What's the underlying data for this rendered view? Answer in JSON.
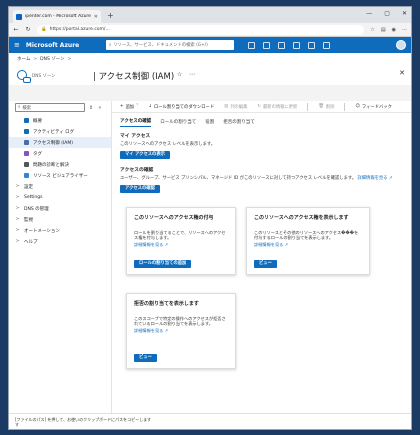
{
  "browser": {
    "tab_title": "ipenter.com - Microsoft Azure",
    "tab_close": "✕",
    "new_tab": "+",
    "url": "https://portal.azure.com/...",
    "window_controls": [
      "—",
      "▢",
      "✕"
    ]
  },
  "azure": {
    "brand": "Microsoft Azure",
    "search_placeholder": "リソース、サービス、ドキュメントの検索 (G+/)"
  },
  "breadcrumb": [
    "ホーム",
    "DNS ゾーン"
  ],
  "resource": {
    "name": "",
    "sub": "DNS ゾーン",
    "page_title": "| アクセス制御 (IAM)"
  },
  "sidebar": {
    "search_placeholder": "検索",
    "items": [
      {
        "label": "概要",
        "chev": "",
        "icon_color": "#0f6cbd"
      },
      {
        "label": "アクティビティ ログ",
        "chev": "",
        "icon_color": "#0f6cbd"
      },
      {
        "label": "アクセス制御 (IAM)",
        "chev": "",
        "icon_color": "#4a6ea9",
        "active": true
      },
      {
        "label": "タグ",
        "chev": "",
        "icon_color": "#8a4fc1"
      },
      {
        "label": "問題の診断と解決",
        "chev": "",
        "icon_color": "#555555"
      },
      {
        "label": "リソース ビジュアライザー",
        "chev": "",
        "icon_color": "#2b88d8"
      },
      {
        "label": "設定",
        "chev": ">",
        "icon_color": ""
      },
      {
        "label": "Settings",
        "chev": ">",
        "icon_color": ""
      },
      {
        "label": "DNS の管理",
        "chev": ">",
        "icon_color": ""
      },
      {
        "label": "監視",
        "chev": ">",
        "icon_color": ""
      },
      {
        "label": "オートメーション",
        "chev": ">",
        "icon_color": ""
      },
      {
        "label": "ヘルプ",
        "chev": ">",
        "icon_color": ""
      }
    ]
  },
  "toolbar": {
    "add": "追加",
    "download": "ロール割り当てのダウンロード",
    "edit_columns": "列の編集",
    "refresh": "最新の情報に更新",
    "delete": "削除",
    "feedback": "フィードバック"
  },
  "tabs": [
    "アクセスの確認",
    "ロールの割り当て",
    "役割",
    "拒否の割り当て"
  ],
  "my_access": {
    "title": "マイ アクセス",
    "desc": "このリソースへのアクセス レベルを表示します。",
    "button": "マイ アクセスの表示"
  },
  "check_access": {
    "title": "アクセスの確認",
    "desc": "ユーザー、グループ、サービス プリンシパル、マネージド ID がこのリソースに対して持つアクセス レベルを確認します。",
    "link": "詳細情報を見る",
    "button": "アクセスの確認"
  },
  "cards": {
    "grant": {
      "title": "このリソースへのアクセス権の付与",
      "desc": "ロールを割り当てることで、リソースへのアクセス権を付与します。",
      "link": "詳細情報を見る",
      "button": "ロールの割り当ての追加"
    },
    "view": {
      "title": "このリソースへのアクセス権を表示します",
      "desc": "このリソースとその他のリソースへのアクセス���を付与するロールの割り当てを表示します。",
      "link": "詳細情報を見る",
      "button": "ビュー"
    },
    "deny": {
      "title": "拒否の割り当てを表示します",
      "desc": "このスコープで特定の操作へのアクセスが拒否されているロールの割り当てを表示します。",
      "link": "詳細情報を見る",
      "button": "ビュー"
    }
  },
  "status": {
    "line1": "[ファイルのパス] を押して、お使いのクリップボードにパスをコピーします",
    "line2": "す"
  }
}
